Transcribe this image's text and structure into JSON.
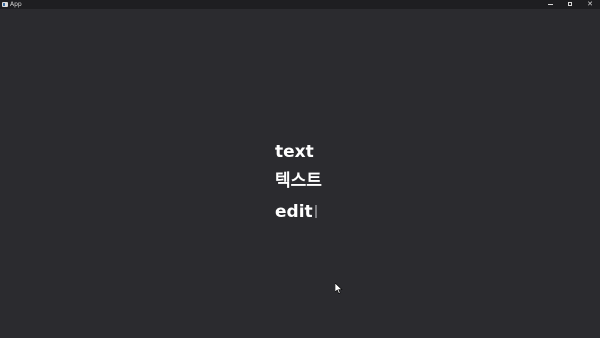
{
  "window": {
    "title": "App",
    "controls": {
      "minimize_icon": "minimize-icon",
      "maximize_icon": "maximize-icon",
      "close_glyph": "✕"
    }
  },
  "content": {
    "lines": [
      "text",
      "텍스트",
      "edit"
    ]
  },
  "colors": {
    "background": "#2b2b2f",
    "titlebar": "#1e1e21",
    "text": "#ffffff",
    "caret": "#7c7c80"
  }
}
